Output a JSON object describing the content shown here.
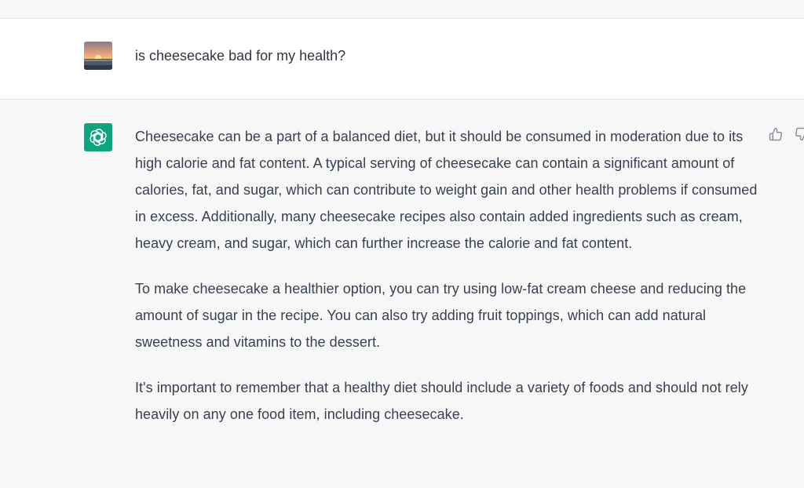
{
  "conversation": {
    "user_message": "is cheesecake bad for my health?",
    "assistant_paragraphs": [
      "Cheesecake can be a part of a balanced diet, but it should be consumed in moderation due to its high calorie and fat content. A typical serving of cheesecake can contain a significant amount of calories, fat, and sugar, which can contribute to weight gain and other health problems if consumed in excess. Additionally, many cheesecake recipes also contain added ingredients such as cream, heavy cream, and sugar, which can further increase the calorie and fat content.",
      "To make cheesecake a healthier option, you can try using low-fat cream cheese and reducing the amount of sugar in the recipe. You can also try adding fruit toppings, which can add natural sweetness and vitamins to the dessert.",
      "It's important to remember that a healthy diet should include a variety of foods and should not rely heavily on any one food item, including cheesecake."
    ]
  },
  "icons": {
    "user_avatar": "sunset-avatar",
    "assistant_avatar": "openai-logo-icon",
    "feedback_up": "thumbs-up-icon",
    "feedback_down": "thumbs-down-icon"
  },
  "colors": {
    "assistant_avatar_bg": "#10a37f",
    "assistant_row_bg": "#f7f7f8",
    "user_row_bg": "#ffffff",
    "text": "#374151"
  }
}
